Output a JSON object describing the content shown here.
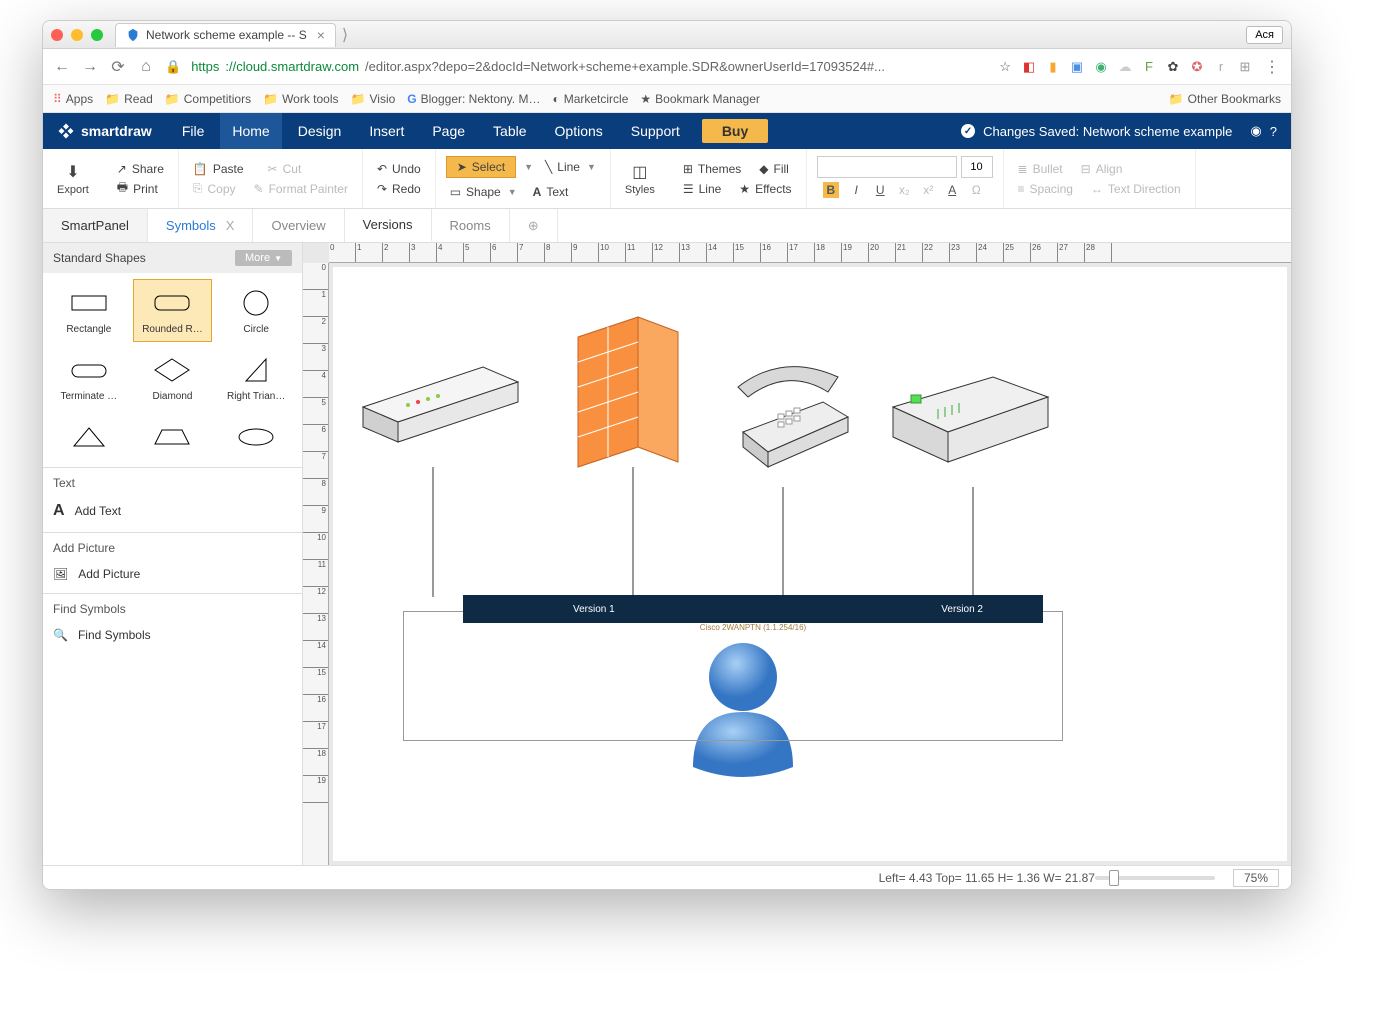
{
  "browser": {
    "tab_title": "Network scheme example -- S",
    "user_label": "Ася",
    "url_secure": "https",
    "url_host": "://cloud.smartdraw.com",
    "url_path": "/editor.aspx?depo=2&docId=Network+scheme+example.SDR&ownerUserId=17093524#...",
    "bookmarks": [
      "Apps",
      "Read",
      "Competitiors",
      "Work tools",
      "Visio",
      "Blogger: Nektony. M…",
      "Marketcircle",
      "Bookmark Manager"
    ],
    "other_bookmarks": "Other Bookmarks"
  },
  "app": {
    "name": "smartdraw",
    "menu": [
      "File",
      "Home",
      "Design",
      "Insert",
      "Page",
      "Table",
      "Options",
      "Support"
    ],
    "buy": "Buy",
    "status": "Changes Saved: Network scheme example"
  },
  "ribbon": {
    "export": "Export",
    "share": "Share",
    "print": "Print",
    "paste": "Paste",
    "cut": "Cut",
    "copy": "Copy",
    "fpainter": "Format Painter",
    "undo": "Undo",
    "redo": "Redo",
    "select": "Select",
    "line": "Line",
    "shape": "Shape",
    "text": "Text",
    "styles": "Styles",
    "themes": "Themes",
    "fill": "Fill",
    "line2": "Line",
    "effects": "Effects",
    "font_size": "10",
    "bullet": "Bullet",
    "align": "Align",
    "spacing": "Spacing",
    "direction": "Text Direction"
  },
  "tabs": {
    "smart": "SmartPanel",
    "symbols": "Symbols",
    "overview": "Overview",
    "versions": "Versions",
    "rooms": "Rooms"
  },
  "side": {
    "shapes_hdr": "Standard Shapes",
    "more": "More",
    "shapes": [
      "Rectangle",
      "Rounded R…",
      "Circle",
      "Terminate …",
      "Diamond",
      "Right Trian…"
    ],
    "text_hdr": "Text",
    "add_text": "Add Text",
    "pic_hdr": "Add Picture",
    "add_pic": "Add Picture",
    "find_hdr": "Find Symbols",
    "find": "Find Symbols"
  },
  "diagram": {
    "v1": "Version 1",
    "v2": "Version 2",
    "sub": "Cisco 2WANPTN (1.1.254/16)"
  },
  "footer": {
    "status": "Left= 4.43 Top= 11.65 H= 1.36 W= 21.87",
    "zoom": "75%"
  }
}
